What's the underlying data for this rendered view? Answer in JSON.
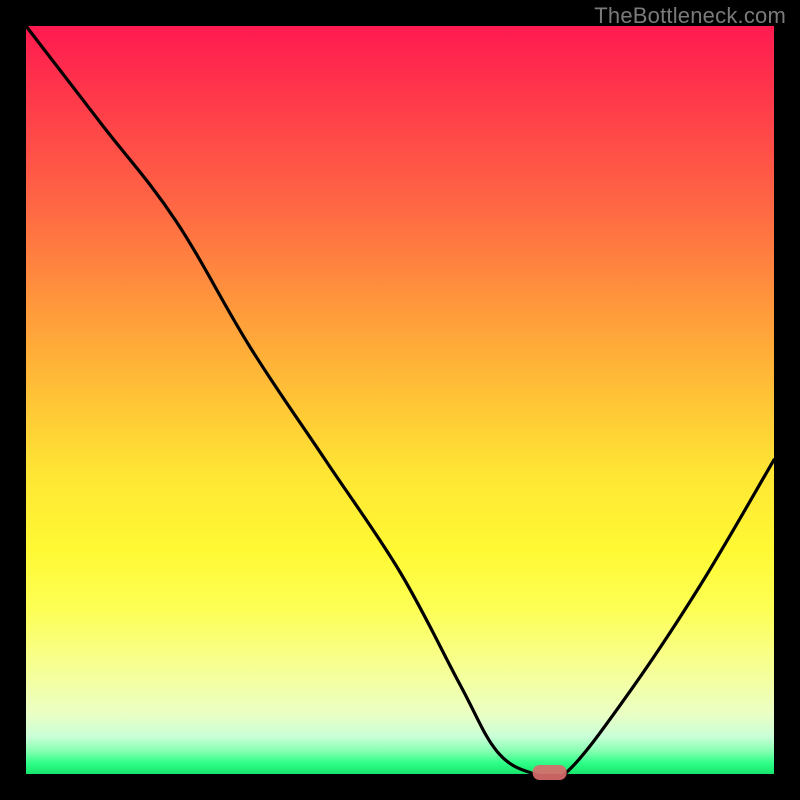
{
  "watermark": "TheBottleneck.com",
  "chart_data": {
    "type": "line",
    "title": "",
    "xlabel": "",
    "ylabel": "",
    "xlim": [
      0,
      100
    ],
    "ylim": [
      0,
      100
    ],
    "grid": false,
    "series": [
      {
        "name": "bottleneck-curve",
        "color": "#000000",
        "x": [
          0,
          10,
          20,
          30,
          40,
          50,
          58,
          63,
          68,
          72,
          80,
          90,
          100
        ],
        "y": [
          100,
          87,
          74,
          57,
          42,
          27,
          12,
          3,
          0,
          0,
          10,
          25,
          42
        ]
      }
    ],
    "marker": {
      "name": "optimal-point",
      "x": 70,
      "y": 0,
      "color": "#d96b6b"
    },
    "gradient_stops": [
      {
        "pos": 0,
        "color": "#ff1a50"
      },
      {
        "pos": 0.5,
        "color": "#ffc436"
      },
      {
        "pos": 0.78,
        "color": "#fdff55"
      },
      {
        "pos": 1.0,
        "color": "#17e56b"
      }
    ]
  }
}
